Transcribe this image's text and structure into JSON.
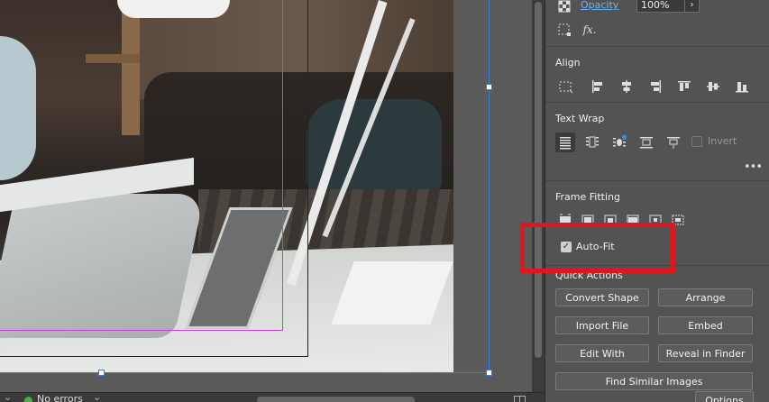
{
  "appearance": {
    "opacity_label": "Opacity",
    "opacity_value": "100%",
    "opacity_arrow": "›",
    "fx_label": "fx."
  },
  "align": {
    "title": "Align"
  },
  "text_wrap": {
    "title": "Text Wrap",
    "invert_label": "Invert",
    "more": "•••"
  },
  "frame_fitting": {
    "title": "Frame Fitting",
    "options_label": "Options",
    "autofit_label": "Auto-Fit",
    "autofit_checked": true,
    "checkmark": "✓"
  },
  "quick_actions": {
    "title": "Quick Actions",
    "buttons": [
      "Convert Shape",
      "Arrange",
      "Import File",
      "Embed",
      "Edit With",
      "Reveal in Finder",
      "Find Similar Images"
    ]
  },
  "status_bar": {
    "chevron": "⌄",
    "errors_text": "No errors"
  },
  "colors": {
    "highlight": "#e2141c",
    "link": "#6ab3f3",
    "status_ok": "#3fb24a",
    "selection": "#3a7bd5",
    "bleed": "#c33fd7"
  }
}
